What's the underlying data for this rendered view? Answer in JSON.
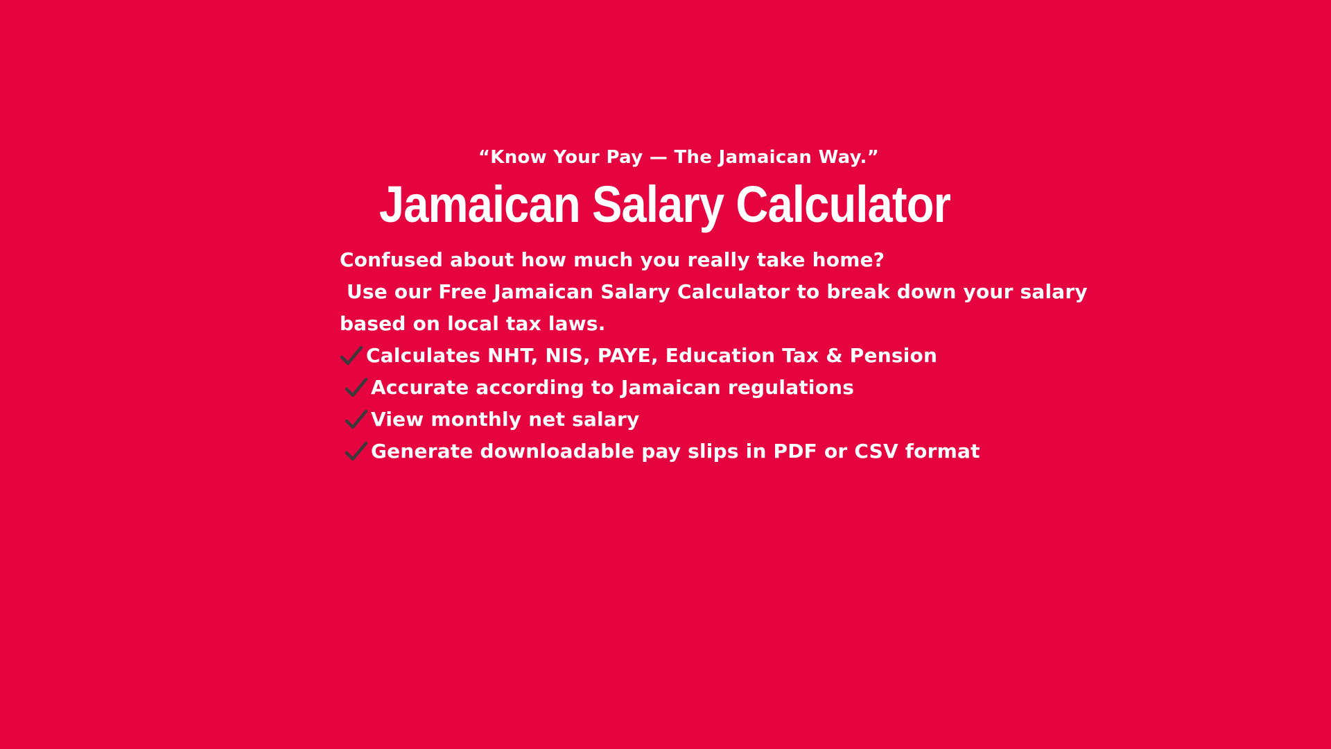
{
  "hero": {
    "tagline": "“Know Your Pay — The Jamaican Way.”",
    "title": "Jamaican Salary Calculator",
    "intro_line_1": "Confused about how much you really take home?",
    "intro_line_2": " Use our Free Jamaican Salary Calculator to break down your salary",
    "intro_line_3": "based on local tax laws."
  },
  "features": [
    {
      "icon": "check-icon",
      "text": "Calculates NHT, NIS, PAYE, Education Tax & Pension"
    },
    {
      "icon": "check-icon",
      "text": "Accurate according to Jamaican regulations"
    },
    {
      "icon": "check-icon",
      "text": "View monthly net salary"
    },
    {
      "icon": "check-icon",
      "text": "Generate downloadable pay slips in PDF or CSV format"
    }
  ],
  "colors": {
    "background": "#e60440",
    "text": "#ffffff",
    "check": "#3a3a3a"
  }
}
